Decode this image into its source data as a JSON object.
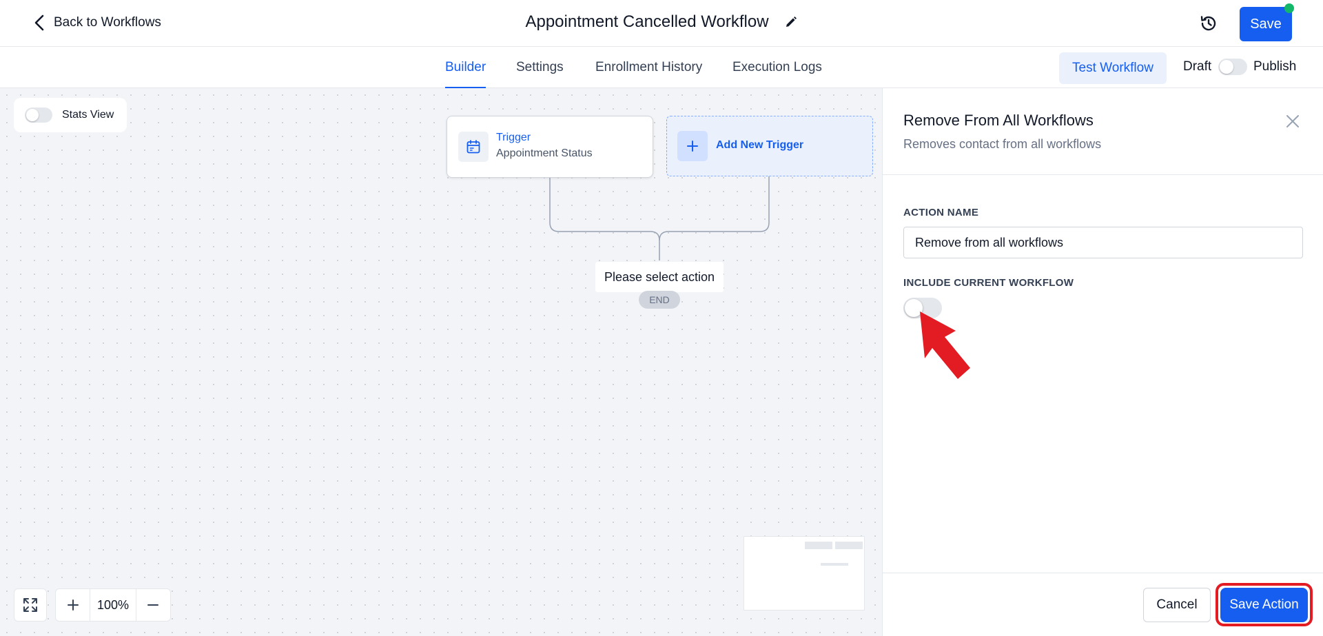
{
  "header": {
    "back_label": "Back to Workflows",
    "title": "Appointment Cancelled Workflow",
    "save_label": "Save"
  },
  "tabs": [
    {
      "label": "Builder",
      "active": true
    },
    {
      "label": "Settings",
      "active": false
    },
    {
      "label": "Enrollment History",
      "active": false
    },
    {
      "label": "Execution Logs",
      "active": false
    }
  ],
  "toolbar": {
    "test_workflow_label": "Test Workflow",
    "draft_label": "Draft",
    "publish_label": "Publish",
    "published": false
  },
  "canvas": {
    "stats_view_label": "Stats View",
    "stats_view_enabled": false,
    "trigger": {
      "title": "Trigger",
      "subtitle": "Appointment Status"
    },
    "add_trigger_label": "Add New Trigger",
    "select_action_label": "Please select action",
    "end_label": "END",
    "zoom_level": "100%"
  },
  "panel": {
    "title": "Remove From All Workflows",
    "subtitle": "Removes contact from all workflows",
    "action_name_label": "ACTION NAME",
    "action_name_value": "Remove from all workflows",
    "include_current_label": "INCLUDE CURRENT WORKFLOW",
    "include_current_enabled": false,
    "cancel_label": "Cancel",
    "save_action_label": "Save Action"
  },
  "colors": {
    "accent": "#155eef",
    "annotation_red": "#e31b23",
    "status_green": "#12b76a"
  }
}
